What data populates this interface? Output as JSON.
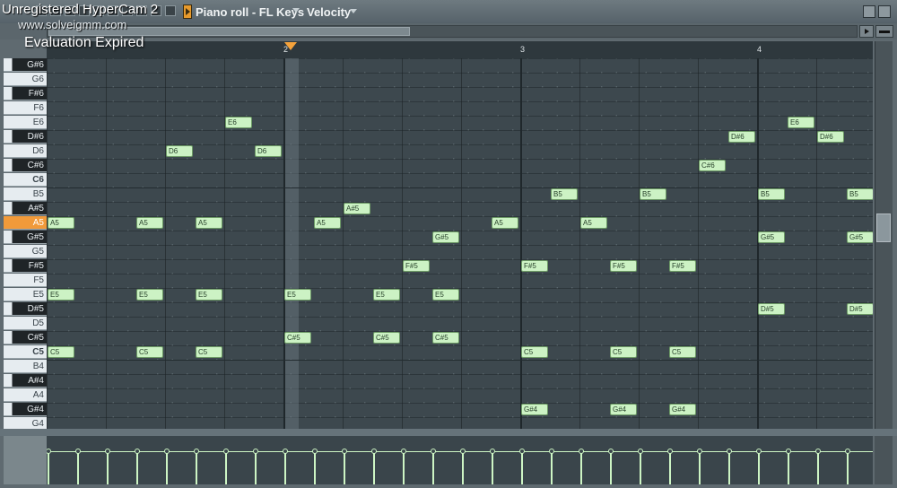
{
  "watermark": {
    "app": "Unregistered HyperCam 2",
    "site": "www.solveigmm.com",
    "status": "Evaluation Expired"
  },
  "window": {
    "title": "Piano roll - FL Keys",
    "parameter": "Velocity"
  },
  "ruler": [
    "2",
    "3",
    "4"
  ],
  "keyboard_keys": [
    {
      "name": "G#6",
      "black": true
    },
    {
      "name": "G6",
      "black": false
    },
    {
      "name": "F#6",
      "black": true
    },
    {
      "name": "F6",
      "black": false
    },
    {
      "name": "E6",
      "black": false
    },
    {
      "name": "D#6",
      "black": true
    },
    {
      "name": "D6",
      "black": false
    },
    {
      "name": "C#6",
      "black": true
    },
    {
      "name": "C6",
      "black": false
    },
    {
      "name": "B5",
      "black": false
    },
    {
      "name": "A#5",
      "black": true
    },
    {
      "name": "A5",
      "black": false,
      "selected": true
    },
    {
      "name": "G#5",
      "black": true
    },
    {
      "name": "G5",
      "black": false
    },
    {
      "name": "F#5",
      "black": true
    },
    {
      "name": "F5",
      "black": false
    },
    {
      "name": "E5",
      "black": false
    },
    {
      "name": "D#5",
      "black": true
    },
    {
      "name": "D5",
      "black": false
    },
    {
      "name": "C#5",
      "black": true
    },
    {
      "name": "C5",
      "black": false
    },
    {
      "name": "B4",
      "black": false
    },
    {
      "name": "A#4",
      "black": true
    },
    {
      "name": "A4",
      "black": false
    },
    {
      "name": "G#4",
      "black": true
    },
    {
      "name": "G4",
      "black": false
    }
  ],
  "notes": [
    {
      "pitch": "A5",
      "step": 0
    },
    {
      "pitch": "E5",
      "step": 0
    },
    {
      "pitch": "C5",
      "step": 0
    },
    {
      "pitch": "A5",
      "step": 3
    },
    {
      "pitch": "E5",
      "step": 3
    },
    {
      "pitch": "C5",
      "step": 3
    },
    {
      "pitch": "D6",
      "step": 4
    },
    {
      "pitch": "A5",
      "step": 5
    },
    {
      "pitch": "E5",
      "step": 5
    },
    {
      "pitch": "C5",
      "step": 5
    },
    {
      "pitch": "E6",
      "step": 6
    },
    {
      "pitch": "D6",
      "step": 7
    },
    {
      "pitch": "E5",
      "step": 8
    },
    {
      "pitch": "C#5",
      "step": 8
    },
    {
      "pitch": "A5",
      "step": 9
    },
    {
      "pitch": "A#5",
      "step": 10
    },
    {
      "pitch": "E5",
      "step": 11
    },
    {
      "pitch": "C#5",
      "step": 11
    },
    {
      "pitch": "F#5",
      "step": 12
    },
    {
      "pitch": "G#5",
      "step": 13
    },
    {
      "pitch": "E5",
      "step": 13
    },
    {
      "pitch": "C#5",
      "step": 13
    },
    {
      "pitch": "A5",
      "step": 15
    },
    {
      "pitch": "F#5",
      "step": 16,
      "editing": true
    },
    {
      "pitch": "C5",
      "step": 16
    },
    {
      "pitch": "G#4",
      "step": 16
    },
    {
      "pitch": "B5",
      "step": 17
    },
    {
      "pitch": "A5",
      "step": 18
    },
    {
      "pitch": "B5",
      "step": 20
    },
    {
      "pitch": "F#5",
      "step": 19
    },
    {
      "pitch": "C5",
      "step": 19
    },
    {
      "pitch": "G#4",
      "step": 19
    },
    {
      "pitch": "F#5",
      "step": 21
    },
    {
      "pitch": "C5",
      "step": 21
    },
    {
      "pitch": "G#4",
      "step": 21
    },
    {
      "pitch": "C#6",
      "step": 22
    },
    {
      "pitch": "D#6",
      "step": 23
    },
    {
      "pitch": "B5",
      "step": 24
    },
    {
      "pitch": "G#5",
      "step": 24
    },
    {
      "pitch": "D#5",
      "step": 24
    },
    {
      "pitch": "E6",
      "step": 25
    },
    {
      "pitch": "D#6",
      "step": 26
    },
    {
      "pitch": "B5",
      "step": 27
    },
    {
      "pitch": "G#5",
      "step": 27
    },
    {
      "pitch": "D#5",
      "step": 27
    },
    {
      "pitch": "C#6",
      "step": 28
    }
  ],
  "velocity_steps": [
    0,
    1,
    2,
    3,
    4,
    5,
    6,
    7,
    8,
    9,
    10,
    11,
    12,
    13,
    14,
    15,
    16,
    17,
    18,
    19,
    20,
    21,
    22,
    23,
    24,
    25,
    26,
    27,
    28
  ]
}
